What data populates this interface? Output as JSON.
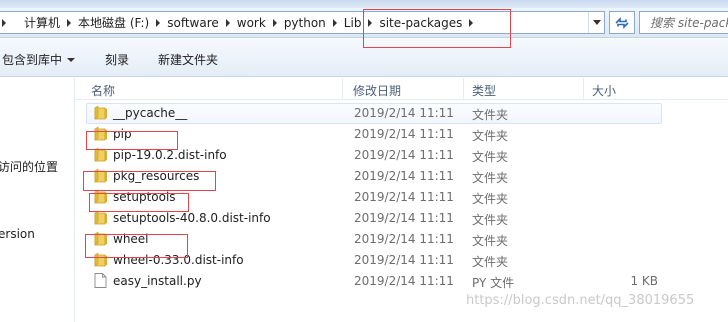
{
  "address_bar": {
    "crumbs": [
      "计算机",
      "本地磁盘 (F:)",
      "software",
      "work",
      "python",
      "Lib",
      "site-packages"
    ]
  },
  "search": {
    "placeholder": "搜索 site-pack"
  },
  "toolbar": {
    "include_label": "包含到库中",
    "burn_label": "刻录",
    "new_folder_label": "新建文件夹"
  },
  "nav_pane": {
    "items": [
      "访问的位置",
      "ersion"
    ]
  },
  "columns": {
    "name": "名称",
    "date": "修改日期",
    "type": "类型",
    "size": "大小"
  },
  "files": [
    {
      "name": "__pycache__",
      "date": "2019/2/14 11:11",
      "type": "文件夹",
      "size": "",
      "icon": "folder-icon"
    },
    {
      "name": "pip",
      "date": "2019/2/14 11:11",
      "type": "文件夹",
      "size": "",
      "icon": "folder-icon"
    },
    {
      "name": "pip-19.0.2.dist-info",
      "date": "2019/2/14 11:11",
      "type": "文件夹",
      "size": "",
      "icon": "folder-icon"
    },
    {
      "name": "pkg_resources",
      "date": "2019/2/14 11:11",
      "type": "文件夹",
      "size": "",
      "icon": "folder-icon"
    },
    {
      "name": "setuptools",
      "date": "2019/2/14 11:11",
      "type": "文件夹",
      "size": "",
      "icon": "folder-icon"
    },
    {
      "name": "setuptools-40.8.0.dist-info",
      "date": "2019/2/14 11:11",
      "type": "文件夹",
      "size": "",
      "icon": "folder-icon"
    },
    {
      "name": "wheel",
      "date": "2019/2/14 11:11",
      "type": "文件夹",
      "size": "",
      "icon": "folder-icon"
    },
    {
      "name": "wheel-0.33.0.dist-info",
      "date": "2019/2/14 11:11",
      "type": "文件夹",
      "size": "",
      "icon": "folder-icon"
    },
    {
      "name": "easy_install.py",
      "date": "2019/2/14 11:11",
      "type": "PY 文件",
      "size": "1 KB",
      "icon": "python-file-icon"
    }
  ],
  "watermark": "https://blog.csdn.net/qq_38019655",
  "colors": {
    "annotation_red": "#e0474c",
    "folder_yellow": "#e8c24a"
  }
}
